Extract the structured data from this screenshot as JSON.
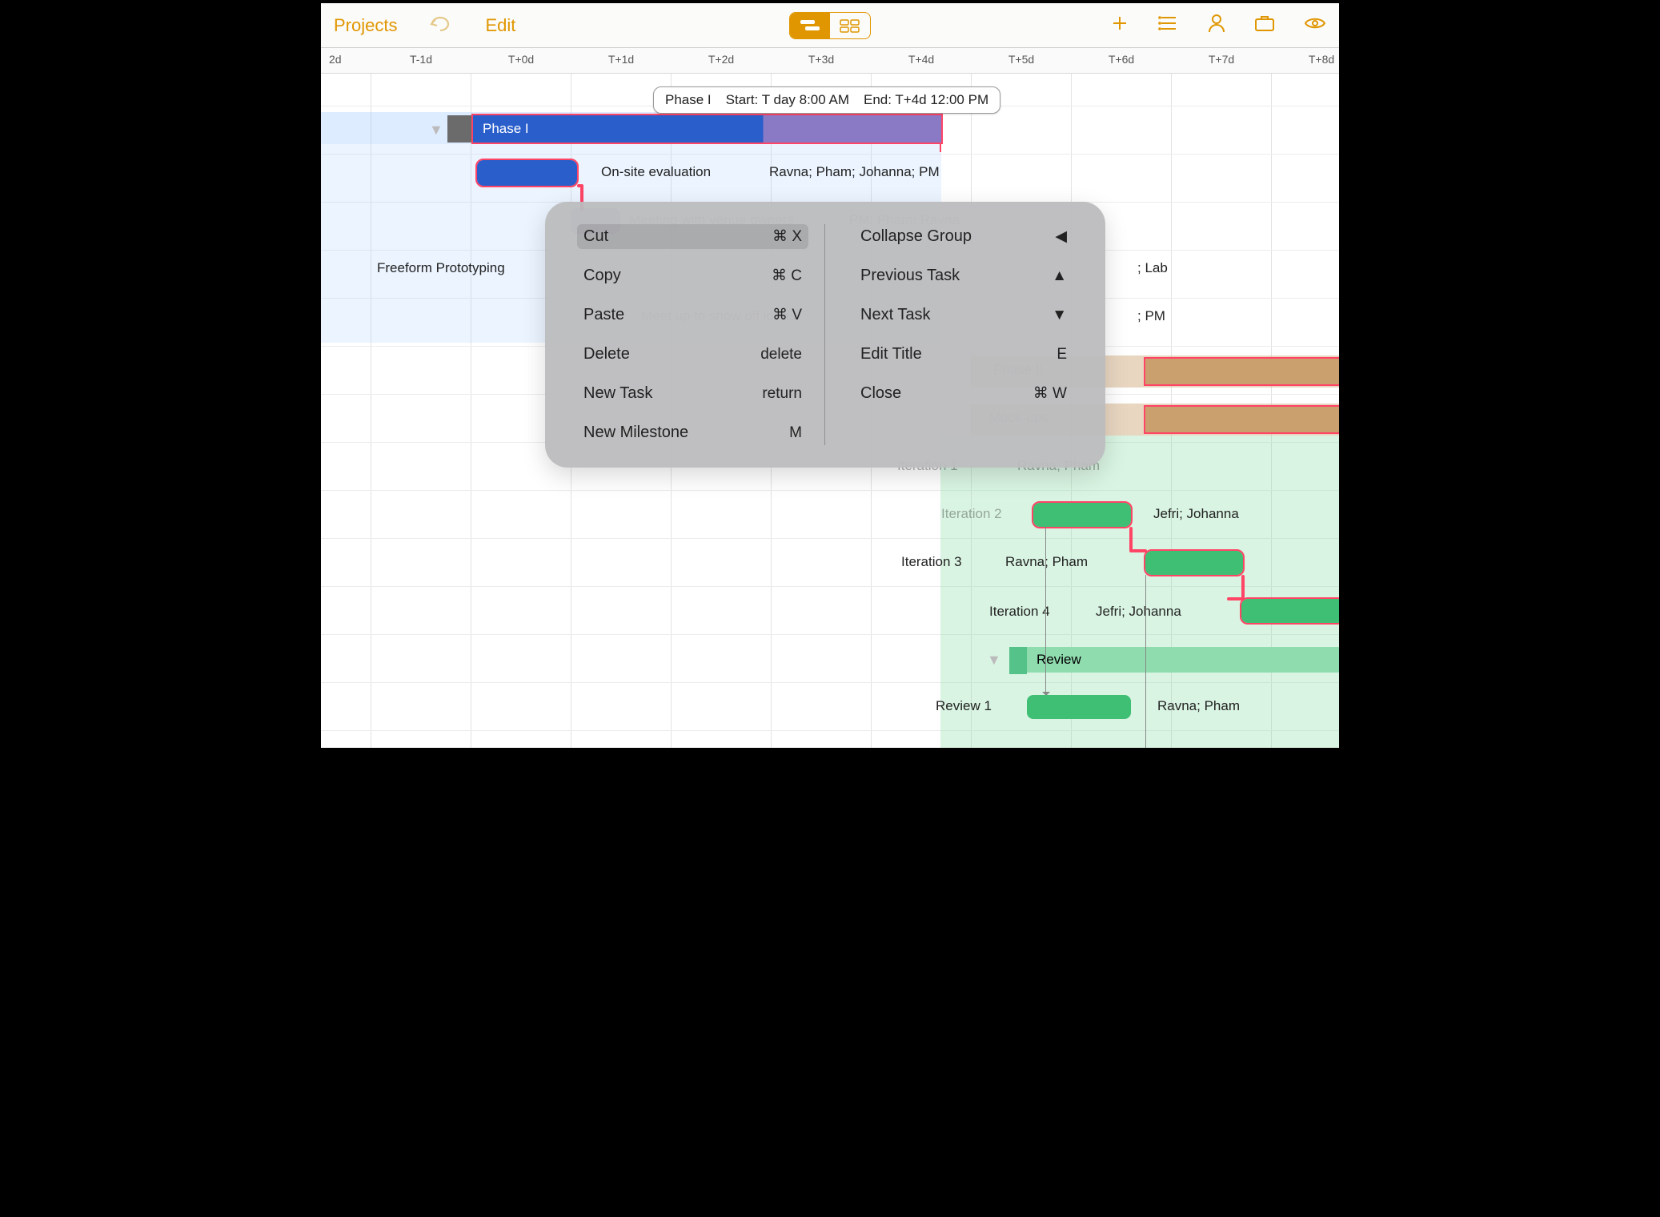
{
  "toolbar": {
    "projects": "Projects",
    "edit": "Edit"
  },
  "days": [
    "2d",
    "T-1d",
    "T+0d",
    "T+1d",
    "T+2d",
    "T+3d",
    "T+4d",
    "T+5d",
    "T+6d",
    "T+7d",
    "T+8d"
  ],
  "tooltip": {
    "name": "Phase I",
    "start": "Start: T day 8:00 AM",
    "end": "End: T+4d 12:00 PM"
  },
  "tasks": {
    "phase1": "Phase I",
    "onsite_label": "On-site evaluation",
    "onsite_res": "Ravna; Pham; Johanna; PM",
    "meeting_label": "Meeting with venue owners",
    "meeting_res": "PM; Pham; Ravna",
    "freeform": "Freeform Prototyping",
    "freeform_res_tail": "; Lab",
    "meetup_label": "Meet up to show off ideas",
    "meetup_res_tail": "; PM",
    "phase2": "Phase II",
    "mockups": "Mock-ups",
    "iter1": "Iteration 1",
    "iter1_res": "Ravna; Pham",
    "iter2": "Iteration 2",
    "iter2_res": "Jefri; Johanna",
    "iter3": "Iteration 3",
    "iter3_res": "Ravna; Pham",
    "iter4": "Iteration 4",
    "iter4_res": "Jefri; Johanna",
    "review": "Review",
    "review1": "Review 1",
    "review1_res": "Ravna; Pham"
  },
  "menu": {
    "left": [
      {
        "label": "Cut",
        "sc": "⌘ X",
        "hi": true
      },
      {
        "label": "Copy",
        "sc": "⌘ C"
      },
      {
        "label": "Paste",
        "sc": "⌘ V"
      },
      {
        "label": "Delete",
        "sc": "delete"
      },
      {
        "label": "New Task",
        "sc": "return"
      },
      {
        "label": "New Milestone",
        "sc": "M"
      }
    ],
    "right": [
      {
        "label": "Collapse Group",
        "sc": "◀"
      },
      {
        "label": "Previous Task",
        "sc": "▲"
      },
      {
        "label": "Next Task",
        "sc": "▼"
      },
      {
        "label": "Edit Title",
        "sc": "E"
      },
      {
        "label": "Close",
        "sc": "⌘ W"
      }
    ]
  }
}
